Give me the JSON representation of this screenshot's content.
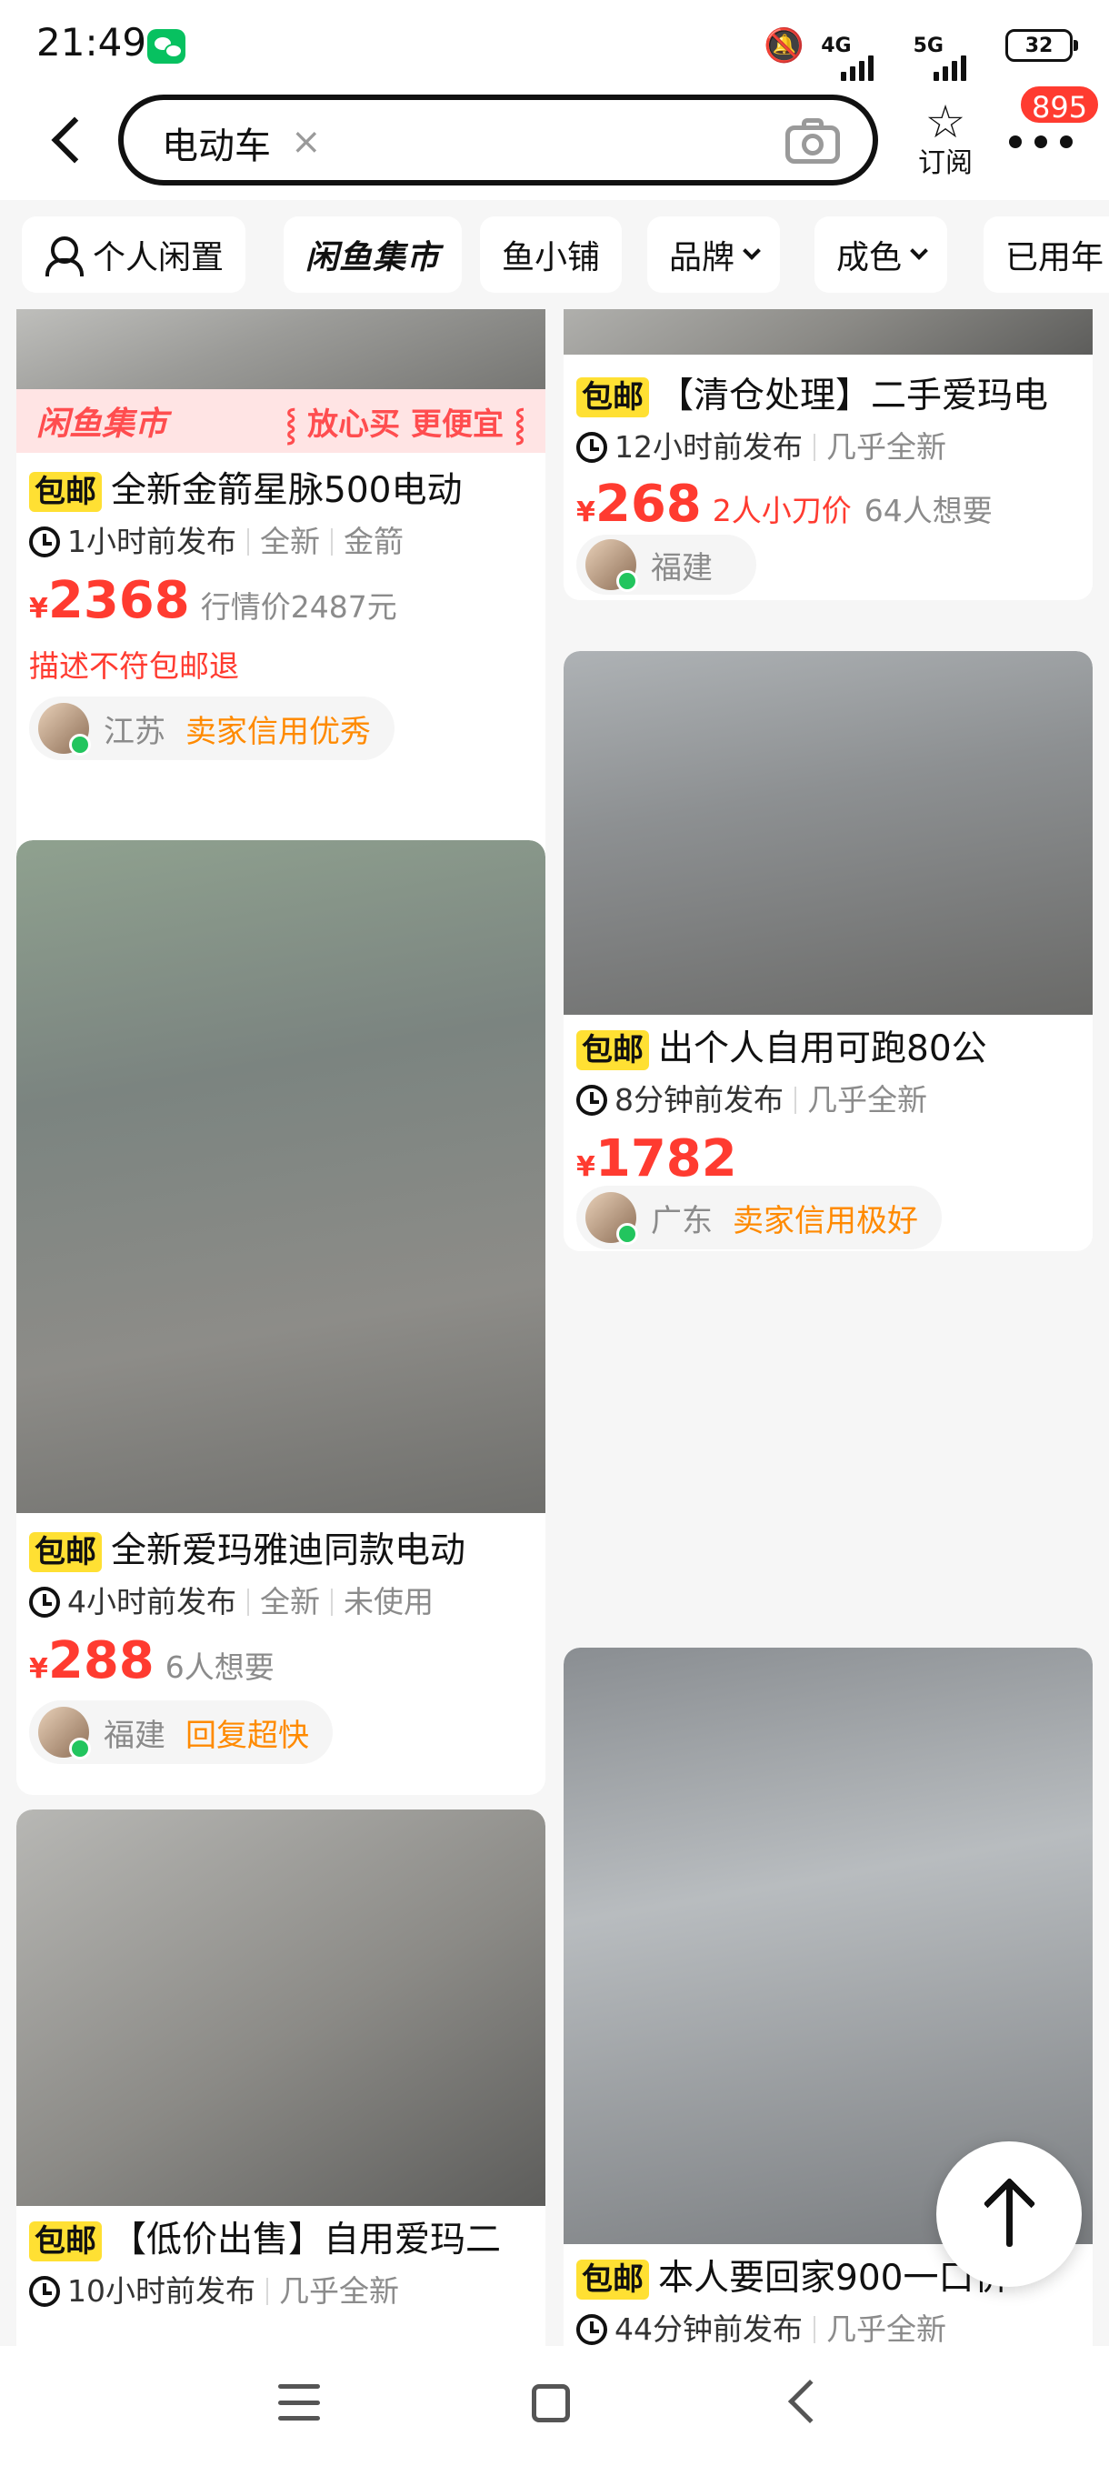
{
  "status": {
    "time": "21:49",
    "net1": "4G",
    "net2": "5G",
    "battery": "32"
  },
  "search": {
    "query": "电动车",
    "clear_glyph": "×"
  },
  "header": {
    "subscribe_label": "订阅",
    "badge_count": "895"
  },
  "filters": [
    {
      "label": "个人闲置"
    },
    {
      "label": "闲鱼集市"
    },
    {
      "label": "鱼小铺"
    },
    {
      "label": "品牌"
    },
    {
      "label": "成色"
    },
    {
      "label": "已用年"
    }
  ],
  "promo": {
    "left": "闲鱼集市",
    "right": "⸾ 放心买 更便宜 ⸾"
  },
  "listings": [
    {
      "tag": "包邮",
      "title": "全新金箭星脉500电动",
      "time": "1小时前发布",
      "condition": "全新",
      "brand": "金箭",
      "price": "2368",
      "price_note": "行情价2487元",
      "price_note2": "",
      "promise": "描述不符包邮退",
      "region": "江苏",
      "credit": "卖家信用优秀"
    },
    {
      "tag": "包邮",
      "title": "【清仓处理】二手爱玛电",
      "time": "12小时前发布",
      "condition": "几乎全新",
      "price": "268",
      "price_note": "2人小刀价",
      "price_note2": "64人想要",
      "region": "福建"
    },
    {
      "tag": "包邮",
      "title": "全新爱玛雅迪同款电动",
      "time": "4小时前发布",
      "condition": "全新",
      "extra": "未使用",
      "price": "288",
      "price_note": "6人想要",
      "region": "福建",
      "credit": "回复超快"
    },
    {
      "tag": "包邮",
      "title": "出个人自用可跑80公",
      "time": "8分钟前发布",
      "condition": "几乎全新",
      "price": "1782",
      "region": "广东",
      "credit": "卖家信用极好"
    },
    {
      "tag": "包邮",
      "title": "【低价出售】自用爱玛二",
      "time": "10小时前发布",
      "condition": "几乎全新"
    },
    {
      "tag": "包邮",
      "title": "本人要回家900一口价",
      "time": "44分钟前发布",
      "condition": "几乎全新"
    }
  ],
  "currency": "¥",
  "colors": {
    "accent_red": "#ff3b30",
    "tag_yellow": "#ffe033",
    "credit_orange": "#ff8a00",
    "online_green": "#22c55e"
  },
  "icons": [
    "back-icon",
    "clear-icon",
    "camera-icon",
    "star-icon",
    "more-icon",
    "person-icon",
    "chevron-down-icon",
    "clock-icon",
    "arrow-up-icon",
    "menu-icon",
    "home-icon",
    "nav-back-icon"
  ]
}
